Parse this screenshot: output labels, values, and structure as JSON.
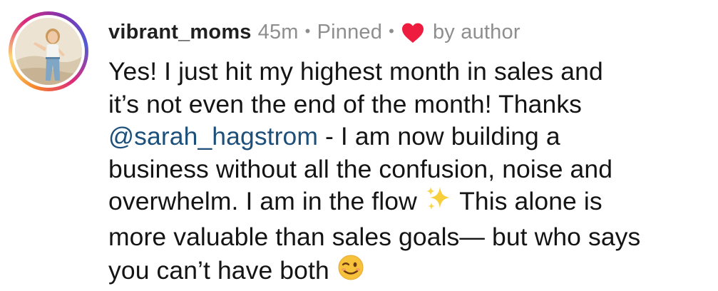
{
  "comment": {
    "username": "vibrant_moms",
    "time_ago": "45m",
    "dot_1": "•",
    "pinned_label": "Pinned",
    "dot_2": "•",
    "liked_by_label": "by author",
    "heart_color": "#ee1d3f",
    "sparkle_icon": "sparkles-emoji",
    "wink_icon": "winking-face-emoji",
    "lines": {
      "l1": "Yes! I just hit my highest month in sales and",
      "l2": "it’s not even the end of the month! Thanks",
      "l3_mention": "@sarah_hagstrom",
      "l3_rest": " - I am now building a",
      "l4": "business without all the confusion, noise and",
      "l5_before": "overwhelm. I am in the flow ",
      "l5_after": " This alone is",
      "l6": "more valuable than sales goals— but who says",
      "l7": "you can’t have both "
    }
  }
}
